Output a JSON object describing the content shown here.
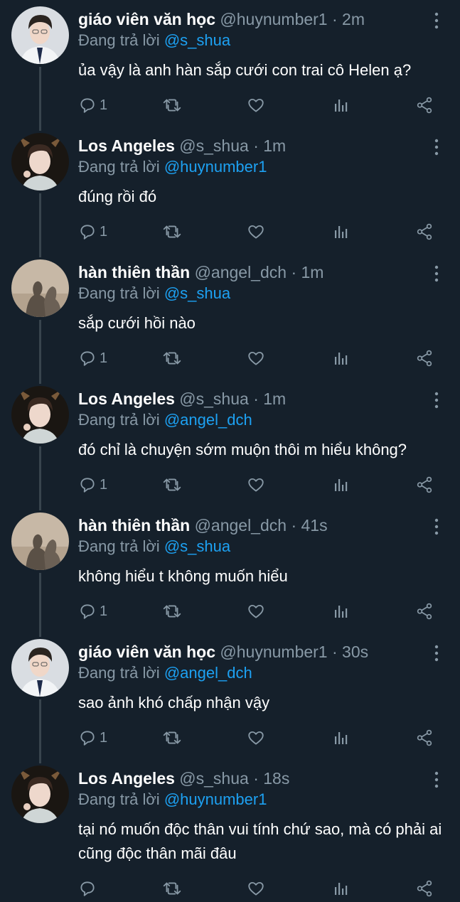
{
  "tweets": [
    {
      "name": "giáo viên văn học",
      "handle": "@huynumber1 · 2m",
      "replying_prefix": "Đang trả lời ",
      "replying_to": "@s_shua",
      "text": "ủa vậy là anh hàn sắp cưới con trai cô Helen ạ?",
      "reply_count": "1",
      "avatar": "teacher"
    },
    {
      "name": "Los Angeles",
      "handle": "@s_shua · 1m",
      "replying_prefix": "Đang trả lời ",
      "replying_to": "@huynumber1",
      "text": "đúng rồi đó",
      "reply_count": "1",
      "avatar": "la"
    },
    {
      "name": "hàn thiên thần",
      "handle": "@angel_dch · 1m",
      "replying_prefix": "Đang trả lời ",
      "replying_to": "@s_shua",
      "text": "sắp cưới hồi nào",
      "reply_count": "1",
      "avatar": "angel"
    },
    {
      "name": "Los Angeles",
      "handle": "@s_shua · 1m",
      "replying_prefix": "Đang trả lời ",
      "replying_to": "@angel_dch",
      "text": "đó chỉ là chuyện sớm muộn thôi m hiểu không?",
      "reply_count": "1",
      "avatar": "la"
    },
    {
      "name": "hàn thiên thần",
      "handle": "@angel_dch · 41s",
      "replying_prefix": "Đang trả lời ",
      "replying_to": "@s_shua",
      "text": "không hiểu t không muốn hiểu",
      "reply_count": "1",
      "avatar": "angel"
    },
    {
      "name": "giáo viên văn học",
      "handle": "@huynumber1 · 30s",
      "replying_prefix": "Đang trả lời ",
      "replying_to": "@angel_dch",
      "text": "sao ảnh khó chấp nhận vậy",
      "reply_count": "1",
      "avatar": "teacher"
    },
    {
      "name": "Los Angeles",
      "handle": "@s_shua · 18s",
      "replying_prefix": "Đang trả lời ",
      "replying_to": "@huynumber1",
      "text": "tại nó muốn độc thân vui tính chứ sao, mà có phải ai cũng độc thân mãi đâu",
      "reply_count": "",
      "avatar": "la"
    }
  ],
  "icons": {
    "reply": "reply-icon",
    "retweet": "retweet-icon",
    "like": "heart-icon",
    "analytics": "analytics-icon",
    "share": "share-icon",
    "more": "more-vertical-icon"
  },
  "colors": {
    "background": "#15202b",
    "muted": "#8899a6",
    "mention": "#1da1f2",
    "thread_line": "#38444d"
  }
}
